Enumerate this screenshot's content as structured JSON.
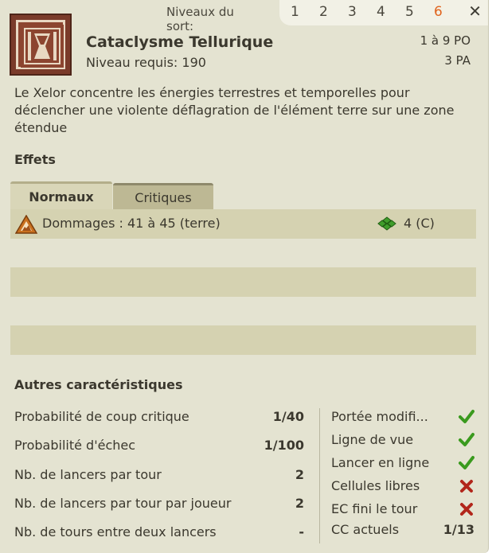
{
  "levels": {
    "label": "Niveaux du sort:",
    "items": [
      "1",
      "2",
      "3",
      "4",
      "5",
      "6"
    ],
    "active_index": 5,
    "close_symbol": "✕"
  },
  "spell": {
    "name": "Cataclysme Tellurique",
    "level_required": "Niveau requis: 190",
    "range": "1 à  9 PO",
    "ap": "3 PA",
    "description": "Le Xelor concentre les énergies terrestres et temporelles pour déclencher une violente déflagration de l'élément terre sur une zone étendue"
  },
  "effects": {
    "title": "Effets",
    "tabs": [
      "Normaux",
      "Critiques"
    ],
    "active_tab": "Normaux",
    "rows": [
      {
        "text": "Dommages : 41 à 45 (terre)",
        "duration": "4 (C)",
        "icon": "earth-element-icon"
      }
    ]
  },
  "others": {
    "title": "Autres caractéristiques",
    "stats": [
      {
        "label": "Probabilité de coup critique",
        "value": "1/40"
      },
      {
        "label": "Probabilité d'échec",
        "value": "1/100"
      },
      {
        "label": "Nb. de lancers par tour",
        "value": "2"
      },
      {
        "label": "Nb. de lancers par tour par joueur",
        "value": "2"
      },
      {
        "label": "Nb. de tours entre deux lancers",
        "value": "-"
      }
    ],
    "flags": [
      {
        "label": "Portée modifi...",
        "state": "yes"
      },
      {
        "label": "Ligne de vue",
        "state": "yes"
      },
      {
        "label": "Lancer en ligne",
        "state": "yes"
      },
      {
        "label": "Cellules libres",
        "state": "no"
      },
      {
        "label": "EC fini le tour",
        "state": "no"
      }
    ],
    "cc": {
      "label": "CC actuels",
      "value": "1/13"
    }
  },
  "colors": {
    "panel_bg": "#e4e3d1",
    "row_dark": "#d5d2b1",
    "active_level": "#e0641e",
    "check_green": "#3a9a1e",
    "cross_red": "#b2261b"
  }
}
